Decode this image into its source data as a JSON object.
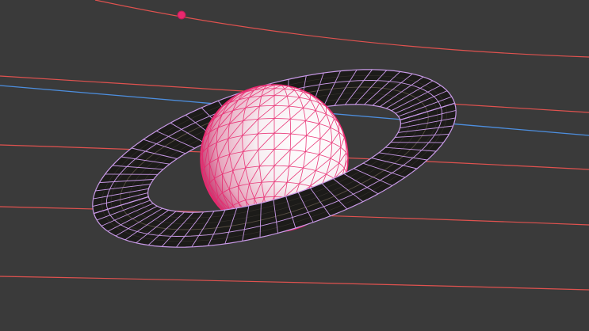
{
  "viewport": {
    "background_color": "#3a3a3a",
    "selection_color": "#e8286e",
    "ring_wire_color": "#c99ae8",
    "orbit_color": "#e0524f",
    "axis_color": "#4d8fe0"
  },
  "scene": {
    "objects": [
      "planet-sphere",
      "planet-ring",
      "orbit-paths",
      "orbit-marker",
      "axis-line"
    ]
  }
}
